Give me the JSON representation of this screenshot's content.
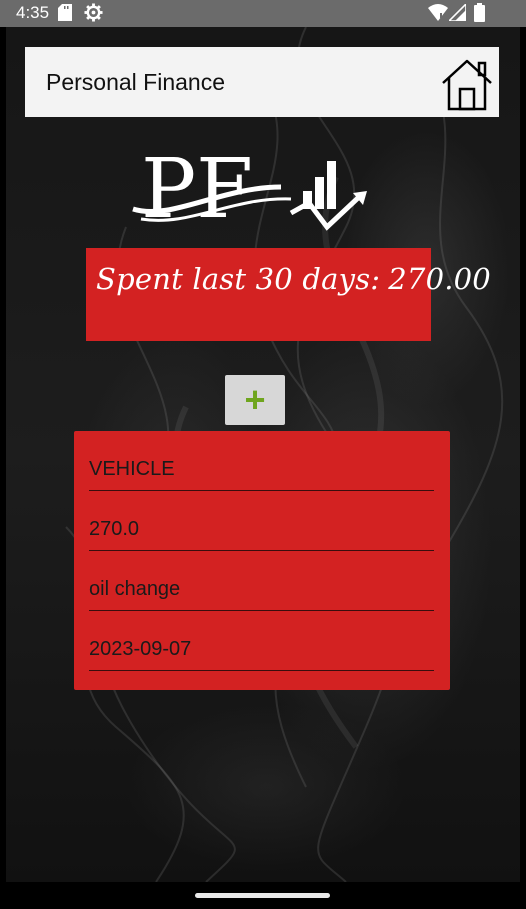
{
  "status_bar": {
    "time": "4:35"
  },
  "toolbar": {
    "title": "Personal Finance"
  },
  "logo": {
    "letters": "PF"
  },
  "summary": {
    "label": "Spent last 30 days:",
    "amount": "270.00"
  },
  "add_button": {
    "symbol": "+"
  },
  "entry": {
    "category": "VEHICLE",
    "amount": "270.0",
    "description": "oil change",
    "date": "2023-09-07"
  },
  "colors": {
    "accent_red": "#d32222",
    "plus_green": "#6fa51e",
    "toolbar_bg": "#f3f3f3",
    "status_bar_bg": "#6b6b6b"
  }
}
